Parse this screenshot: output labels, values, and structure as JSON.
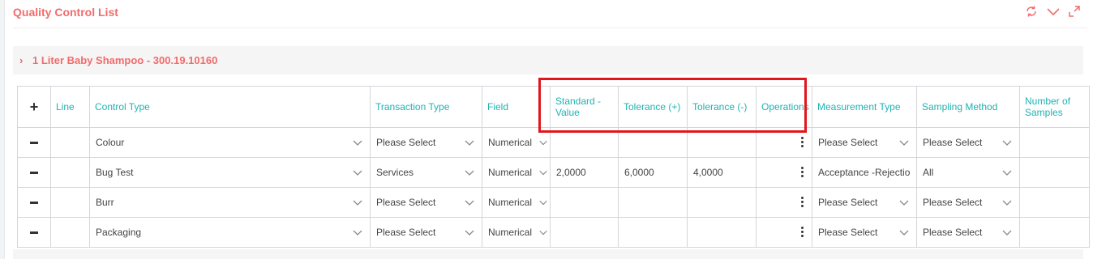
{
  "panel": {
    "title": "Quality Control List"
  },
  "section": {
    "title": "1 Liter Baby Shampoo - 300.19.10160"
  },
  "table": {
    "add_symbol": "+",
    "headers": {
      "line": "Line",
      "control_type": "Control Type",
      "transaction_type": "Transaction Type",
      "field": "Field",
      "standard_value": "Standard - Value",
      "tolerance_plus": "Tolerance (+)",
      "tolerance_minus": "Tolerance (-)",
      "operations": "Operations",
      "measurement_type": "Measurement Type",
      "sampling_method": "Sampling Method",
      "number_of_samples": "Number of Samples"
    },
    "rows": [
      {
        "line": "",
        "control_type": "Colour",
        "transaction_type": "Please Select",
        "field": "Numerical",
        "standard_value": "",
        "tolerance_plus": "",
        "tolerance_minus": "",
        "measurement_type": "Please Select",
        "sampling_method": "Please Select",
        "number_of_samples": ""
      },
      {
        "line": "",
        "control_type": "Bug Test",
        "transaction_type": "Services",
        "field": "Numerical",
        "standard_value": "2,0000",
        "tolerance_plus": "6,0000",
        "tolerance_minus": "4,0000",
        "measurement_type": "Acceptance -Rejectio",
        "sampling_method": "All",
        "number_of_samples": ""
      },
      {
        "line": "",
        "control_type": "Burr",
        "transaction_type": "Please Select",
        "field": "Numerical",
        "standard_value": "",
        "tolerance_plus": "",
        "tolerance_minus": "",
        "measurement_type": "Please Select",
        "sampling_method": "Please Select",
        "number_of_samples": ""
      },
      {
        "line": "",
        "control_type": "Packaging",
        "transaction_type": "Please Select",
        "field": "Numerical",
        "standard_value": "",
        "tolerance_plus": "",
        "tolerance_minus": "",
        "measurement_type": "Please Select",
        "sampling_method": "Please Select",
        "number_of_samples": ""
      }
    ]
  },
  "icons": {
    "refresh": "refresh-icon",
    "collapse": "chevron-down-icon",
    "expand": "expand-icon",
    "section_toggle": "chevron-right-icon"
  },
  "colors": {
    "accent": "#f26b6b",
    "header_text": "#1fb3b3",
    "highlight": "#e0161b"
  }
}
